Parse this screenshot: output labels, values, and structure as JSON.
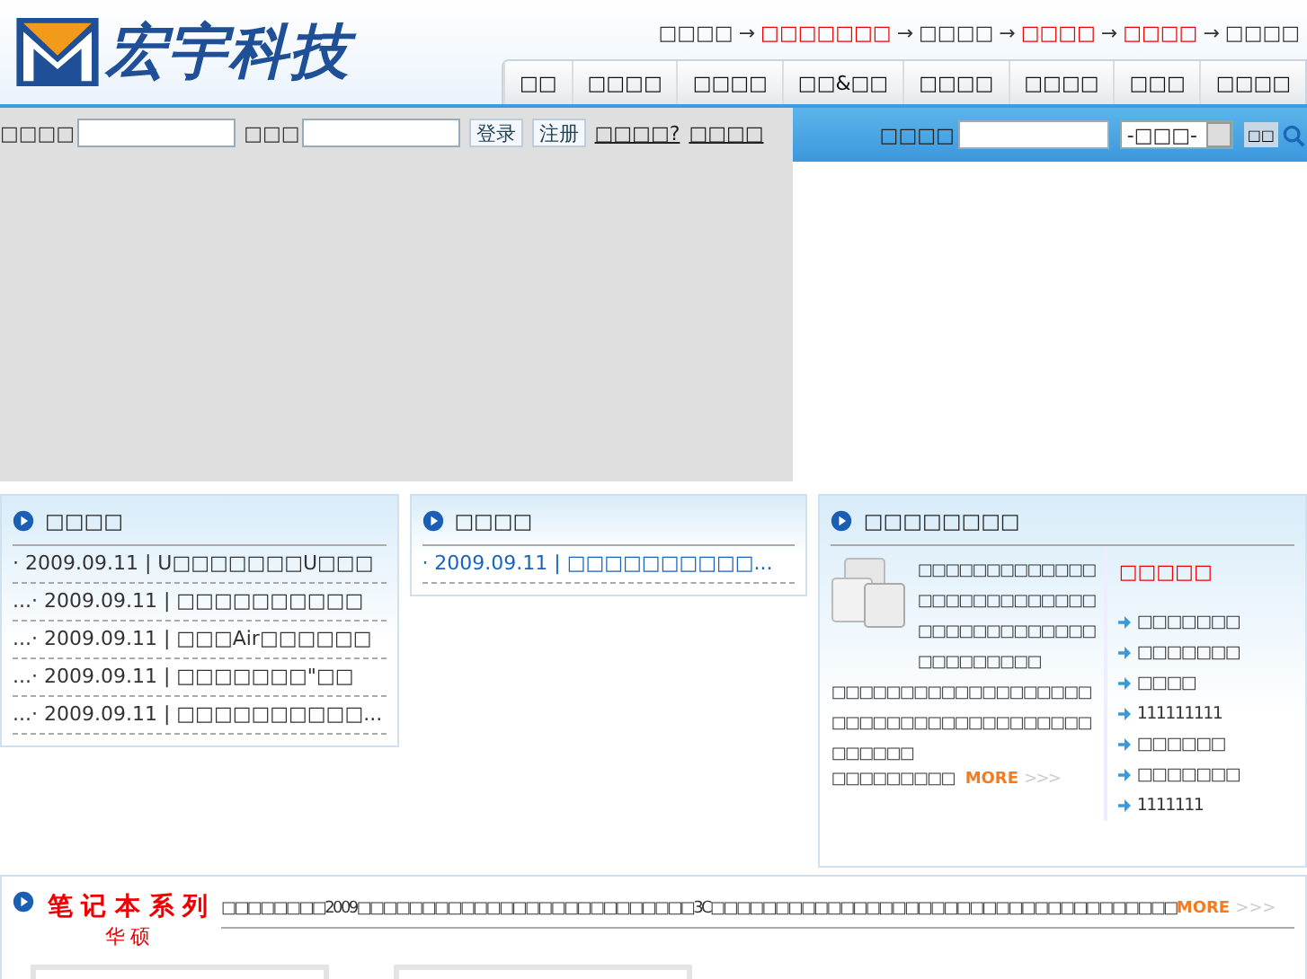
{
  "header": {
    "logo_text": "宏宇科技",
    "top_links": [
      {
        "label": "□□□□",
        "highlighted": false
      },
      {
        "label": "□□□□□□□",
        "highlighted": true
      },
      {
        "label": "□□□□",
        "highlighted": false
      },
      {
        "label": "□□□□",
        "highlighted": true
      },
      {
        "label": "□□□□",
        "highlighted": true
      },
      {
        "label": "□□□□",
        "highlighted": false
      }
    ],
    "separator": "→",
    "nav": [
      "□□",
      "□□□□",
      "□□□□",
      "□□&□□",
      "□□□□",
      "□□□□",
      "□□□",
      "□□□□"
    ]
  },
  "login": {
    "user_label": "□□□□",
    "password_label": "□□□",
    "buttons": [
      "登录",
      "注册"
    ],
    "links": [
      "□□□□?",
      "□□□□"
    ]
  },
  "search": {
    "label": "□□□□",
    "select": "-□□□-",
    "go": "□□"
  },
  "panels": [
    {
      "title": "□□□□",
      "items": [
        {
          "text": "· 2009.09.11 | U□□□□□□□U□□□",
          "highlighted": false
        },
        {
          "text": "...· 2009.09.11 | □□□□□□□□□□",
          "highlighted": false
        },
        {
          "text": "...· 2009.09.11 | □□□Air□□□□□□",
          "highlighted": false
        },
        {
          "text": "...· 2009.09.11 | □□□□□□□\"□□",
          "highlighted": false
        },
        {
          "text": "...· 2009.09.11 | □□□□□□□□□□...",
          "highlighted": false
        }
      ]
    },
    {
      "title": "□□□□",
      "items": [
        {
          "text": "· 2009.09.11 | □□□□□□□□□□...",
          "highlighted": true
        }
      ]
    }
  ],
  "about": {
    "title": "□□□□□□□□",
    "intro": "□□□□□□□□□□□□□□□□□□□□□□□□□□□□□□□□□□□□□□□□□□□□□□□□",
    "body": "□□□□□□□□□□□□□□□□□□□□□□□□□□□□□□□□□□□□□□□□□□□□",
    "tail": "□□□□□□□□□",
    "more": "MORE",
    "more_arrows": ">>>",
    "side_title": "□□□□□",
    "side_items": [
      "□□□□□□□",
      "□□□□□□□",
      "□□□□",
      "111111111",
      "□□□□□□",
      "□□□□□□□",
      "1111111"
    ]
  },
  "series": {
    "title": "笔 记 本 系 列",
    "subtitle": "华 硕",
    "text": "□□□□□□□□2009□□□□□□□□□□□□□□□□□□□□□□□□□□3C□□□□□□□□□□□□□□□□□□□□□□□□□□□□□□□□□□□□",
    "more": "MORE",
    "more_arrows": ">>>"
  }
}
